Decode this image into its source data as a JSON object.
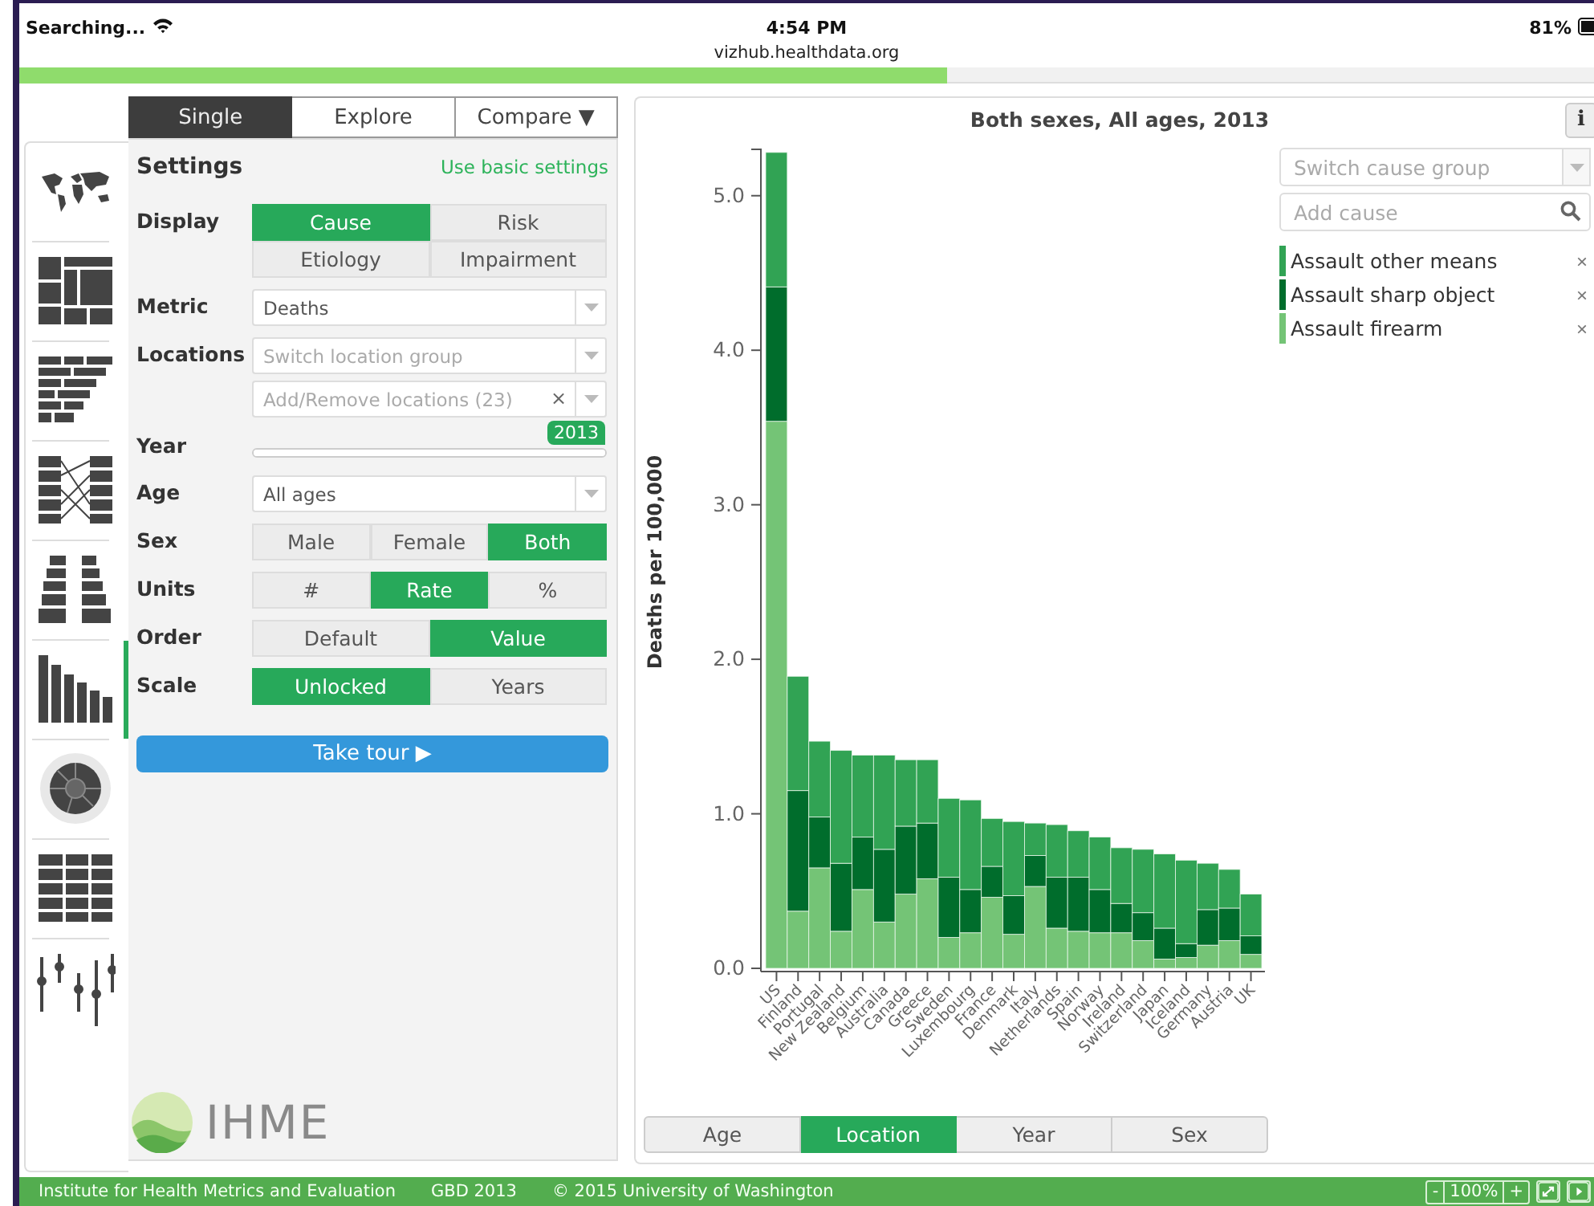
{
  "status_bar": {
    "carrier": "Searching...",
    "time": "4:54 PM",
    "url": "vizhub.healthdata.org",
    "battery": "81%"
  },
  "views": [
    {
      "kind": "map",
      "selected": false
    },
    {
      "kind": "treemap",
      "selected": false
    },
    {
      "kind": "stacked",
      "selected": false
    },
    {
      "kind": "ranking",
      "selected": false
    },
    {
      "kind": "pyramid",
      "selected": false
    },
    {
      "kind": "bar",
      "selected": true
    },
    {
      "kind": "sunburst",
      "selected": false
    },
    {
      "kind": "table",
      "selected": false
    },
    {
      "kind": "sliders",
      "selected": false
    }
  ],
  "mode_tabs": [
    {
      "label": "Single",
      "selected": true
    },
    {
      "label": "Explore",
      "selected": false
    },
    {
      "label": "Compare ▼",
      "selected": false
    }
  ],
  "settings": {
    "title": "Settings",
    "link": "Use basic settings",
    "rows": [
      {
        "kind": "segmented",
        "label": "Display",
        "options": [
          {
            "label": "Cause",
            "selected": true
          },
          {
            "label": "Risk",
            "selected": false
          },
          {
            "label": "Etiology",
            "selected": false
          },
          {
            "label": "Impairment",
            "selected": false
          }
        ]
      },
      {
        "kind": "select",
        "label": "Metric",
        "fields": [
          {
            "value": "Deaths"
          }
        ]
      },
      {
        "kind": "select",
        "label": "Locations",
        "fields": [
          {
            "placeholder": "Switch location group"
          },
          {
            "placeholder": "Add/Remove locations (23)",
            "clear": "×"
          }
        ]
      },
      {
        "kind": "slider",
        "label": "Year",
        "level": 1,
        "reading": "2013"
      },
      {
        "kind": "select",
        "label": "Age",
        "fields": [
          {
            "value": "All ages"
          }
        ]
      },
      {
        "kind": "segmented",
        "label": "Sex",
        "options": [
          {
            "label": "Male",
            "selected": false
          },
          {
            "label": "Female",
            "selected": false
          },
          {
            "label": "Both",
            "selected": true
          }
        ]
      },
      {
        "kind": "segmented",
        "label": "Units",
        "options": [
          {
            "label": "#",
            "selected": false
          },
          {
            "label": "Rate",
            "selected": true
          },
          {
            "label": "%",
            "selected": false
          }
        ]
      },
      {
        "kind": "segmented",
        "label": "Order",
        "options": [
          {
            "label": "Default",
            "selected": false
          },
          {
            "label": "Value",
            "selected": true
          }
        ]
      },
      {
        "kind": "segmented",
        "label": "Scale",
        "options": [
          {
            "label": "Unlocked",
            "selected": true
          },
          {
            "label": "Years",
            "selected": false
          }
        ]
      }
    ],
    "tour_button": "Take tour ▶",
    "logo": "IHME"
  },
  "chart": {
    "info": "i",
    "cause_group": {
      "placeholder": "Switch cause group"
    },
    "add_cause": {
      "placeholder": "Add cause"
    },
    "remove_buttons": [
      "×",
      "×",
      "×"
    ],
    "chart_data": {
      "type": "bar",
      "stacked": true,
      "title": "Both sexes, All ages, 2013",
      "ylabel": "Deaths per 100,000",
      "categories": [
        "US",
        "Finland",
        "Portugal",
        "New Zealand",
        "Belgium",
        "Australia",
        "Canada",
        "Greece",
        "Sweden",
        "Luxembourg",
        "France",
        "Denmark",
        "Italy",
        "Netherlands",
        "Spain",
        "Norway",
        "Ireland",
        "Switzerland",
        "Japan",
        "Iceland",
        "Germany",
        "Austria",
        "UK"
      ],
      "series": [
        {
          "name": "Assault firearm",
          "color": "#74c476",
          "values": [
            3.54,
            0.37,
            0.65,
            0.24,
            0.51,
            0.3,
            0.48,
            0.58,
            0.2,
            0.23,
            0.46,
            0.22,
            0.53,
            0.26,
            0.24,
            0.23,
            0.23,
            0.18,
            0.06,
            0.07,
            0.15,
            0.18,
            0.09
          ]
        },
        {
          "name": "Assault sharp object",
          "color": "#006d2c",
          "values": [
            0.87,
            0.78,
            0.33,
            0.44,
            0.34,
            0.47,
            0.44,
            0.36,
            0.39,
            0.28,
            0.2,
            0.25,
            0.2,
            0.33,
            0.35,
            0.28,
            0.19,
            0.18,
            0.2,
            0.09,
            0.23,
            0.21,
            0.12
          ]
        },
        {
          "name": "Assault other means",
          "color": "#31a354",
          "values": [
            0.87,
            0.74,
            0.49,
            0.73,
            0.53,
            0.61,
            0.43,
            0.41,
            0.51,
            0.58,
            0.31,
            0.48,
            0.21,
            0.34,
            0.3,
            0.34,
            0.36,
            0.41,
            0.48,
            0.54,
            0.3,
            0.25,
            0.27
          ]
        }
      ],
      "ylim": [
        0,
        5.3
      ],
      "yticks": [
        {
          "value": 0,
          "label": "0.0"
        },
        {
          "value": 1,
          "label": "1.0"
        },
        {
          "value": 2,
          "label": "2.0"
        },
        {
          "value": 3,
          "label": "3.0"
        },
        {
          "value": 4,
          "label": "4.0"
        },
        {
          "value": 5,
          "label": "5.0"
        }
      ]
    },
    "view_tabs": [
      {
        "label": "Age",
        "selected": false
      },
      {
        "label": "Location",
        "selected": true
      },
      {
        "label": "Year",
        "selected": false
      },
      {
        "label": "Sex",
        "selected": false
      }
    ]
  },
  "footer": {
    "org": "Institute for Health Metrics and Evaluation",
    "edition": "GBD 2013",
    "copyright": "© 2015 University of Washington",
    "zoom_out": "-",
    "zoom": "100%",
    "zoom_in": "+"
  }
}
